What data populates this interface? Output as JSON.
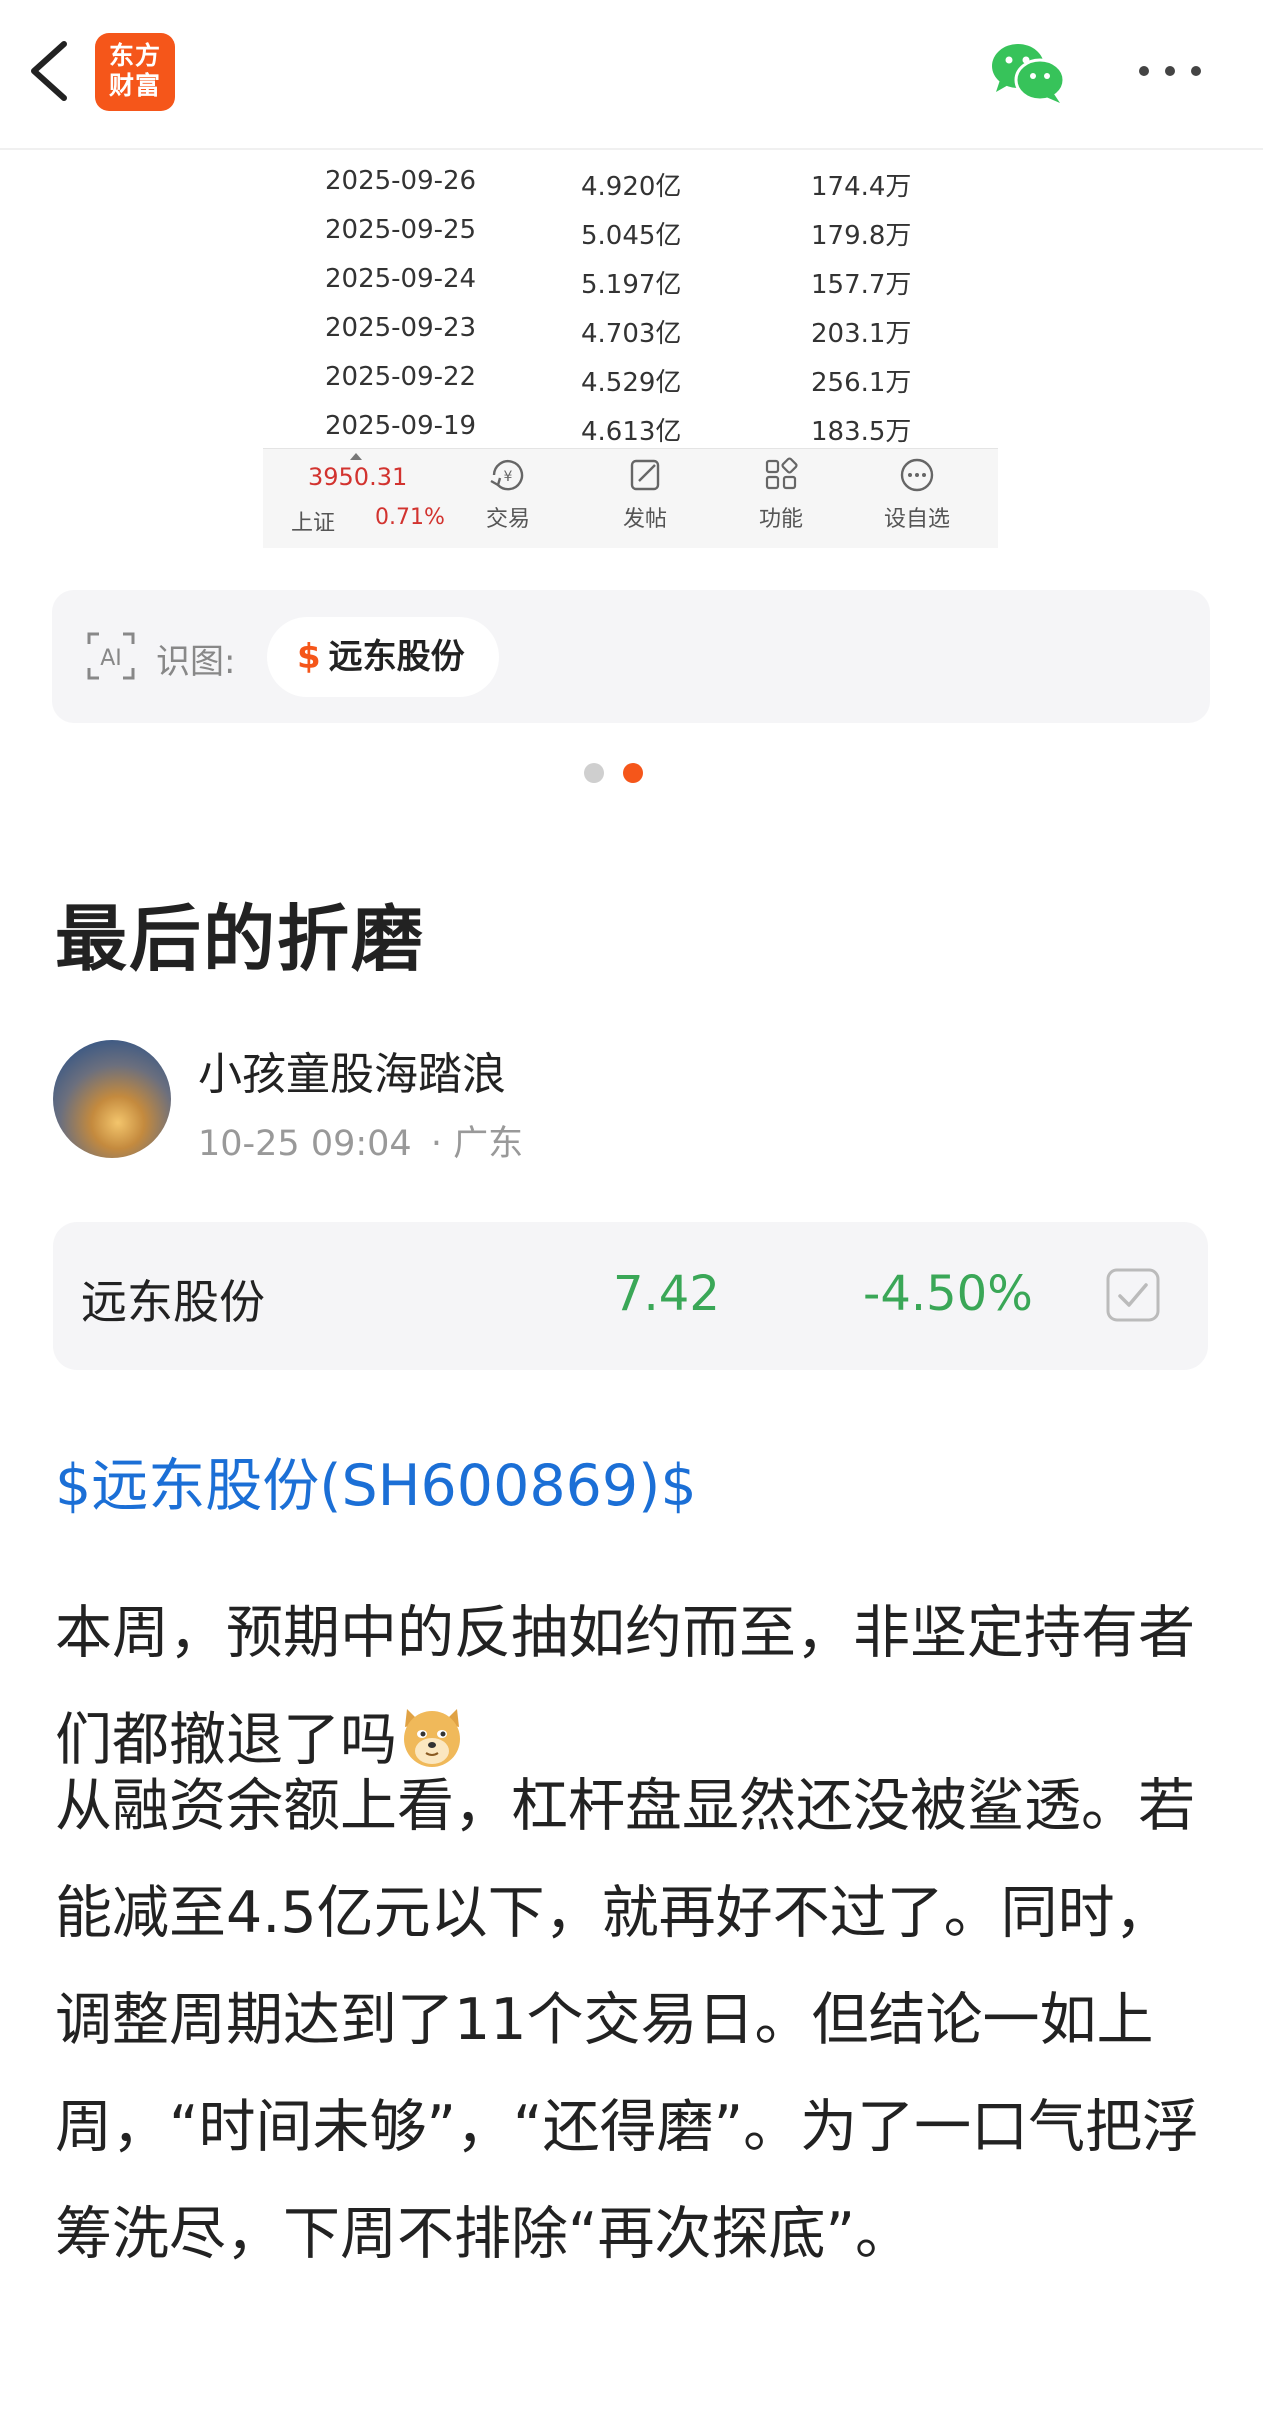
{
  "app": {
    "logo_line1": "东方",
    "logo_line2": "财富"
  },
  "margin_table": {
    "rows": [
      {
        "date": "2025-09-26",
        "balance": "4.920亿",
        "volume": "174.4万"
      },
      {
        "date": "2025-09-25",
        "balance": "5.045亿",
        "volume": "179.8万"
      },
      {
        "date": "2025-09-24",
        "balance": "5.197亿",
        "volume": "157.7万"
      },
      {
        "date": "2025-09-23",
        "balance": "4.703亿",
        "volume": "203.1万"
      },
      {
        "date": "2025-09-22",
        "balance": "4.529亿",
        "volume": "256.1万"
      },
      {
        "date": "2025-09-19",
        "balance": "4.613亿",
        "volume": "183.5万"
      }
    ]
  },
  "mini_toolbar": {
    "index_value": "3950.31",
    "index_name": "上证",
    "index_change": "0.71%",
    "items": [
      "交易",
      "发帖",
      "功能",
      "设自选"
    ]
  },
  "ai_card": {
    "label": "识图:",
    "stock_name": "远东股份",
    "stock_symbol": "$"
  },
  "carousel": {
    "count": 2,
    "active": 2
  },
  "article": {
    "title": "最后的折磨",
    "author": "小孩童股海踏浪",
    "time": "10-25 09:04",
    "location": "· 广东",
    "quote": {
      "name": "远东股份",
      "price": "7.42",
      "change": "-4.50%"
    },
    "stock_link": "$远东股份(SH600869)$",
    "para1": "本周，预期中的反抽如约而至，非坚定持有者们都撤退了吗",
    "para2": "从融资余额上看，杠杆盘显然还没被鲨透。若能减至4.5亿元以下，就再好不过了。同时，调整周期达到了11个交易日。但结论一如上周，“时间未够”，“还得磨”。为了一口气把浮筹洗尽，下周不排除“再次探底”。"
  },
  "colors": {
    "brand": "#f5561a",
    "down": "#3aa757",
    "up": "#d2332f",
    "link": "#1b6fd6"
  },
  "icons": [
    "back-icon",
    "wechat-icon",
    "more-icon",
    "ai-icon",
    "checkbox-icon",
    "doge-emoji"
  ]
}
